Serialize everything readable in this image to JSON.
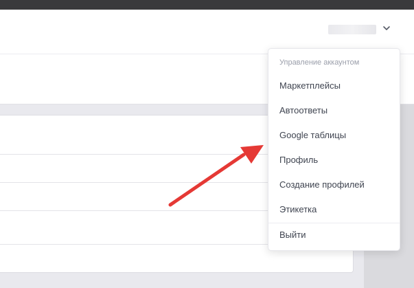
{
  "header": {
    "user_menu_icon": "chevron-down-icon"
  },
  "account_menu": {
    "title": "Управление аккаунтом",
    "items": [
      {
        "label": "Маркетплейсы"
      },
      {
        "label": "Автоответы"
      },
      {
        "label": "Google таблицы"
      },
      {
        "label": "Профиль"
      },
      {
        "label": "Создание профилей"
      },
      {
        "label": "Этикетка"
      }
    ],
    "logout_label": "Выйти"
  },
  "annotation": {
    "arrow_color": "#e53935"
  }
}
